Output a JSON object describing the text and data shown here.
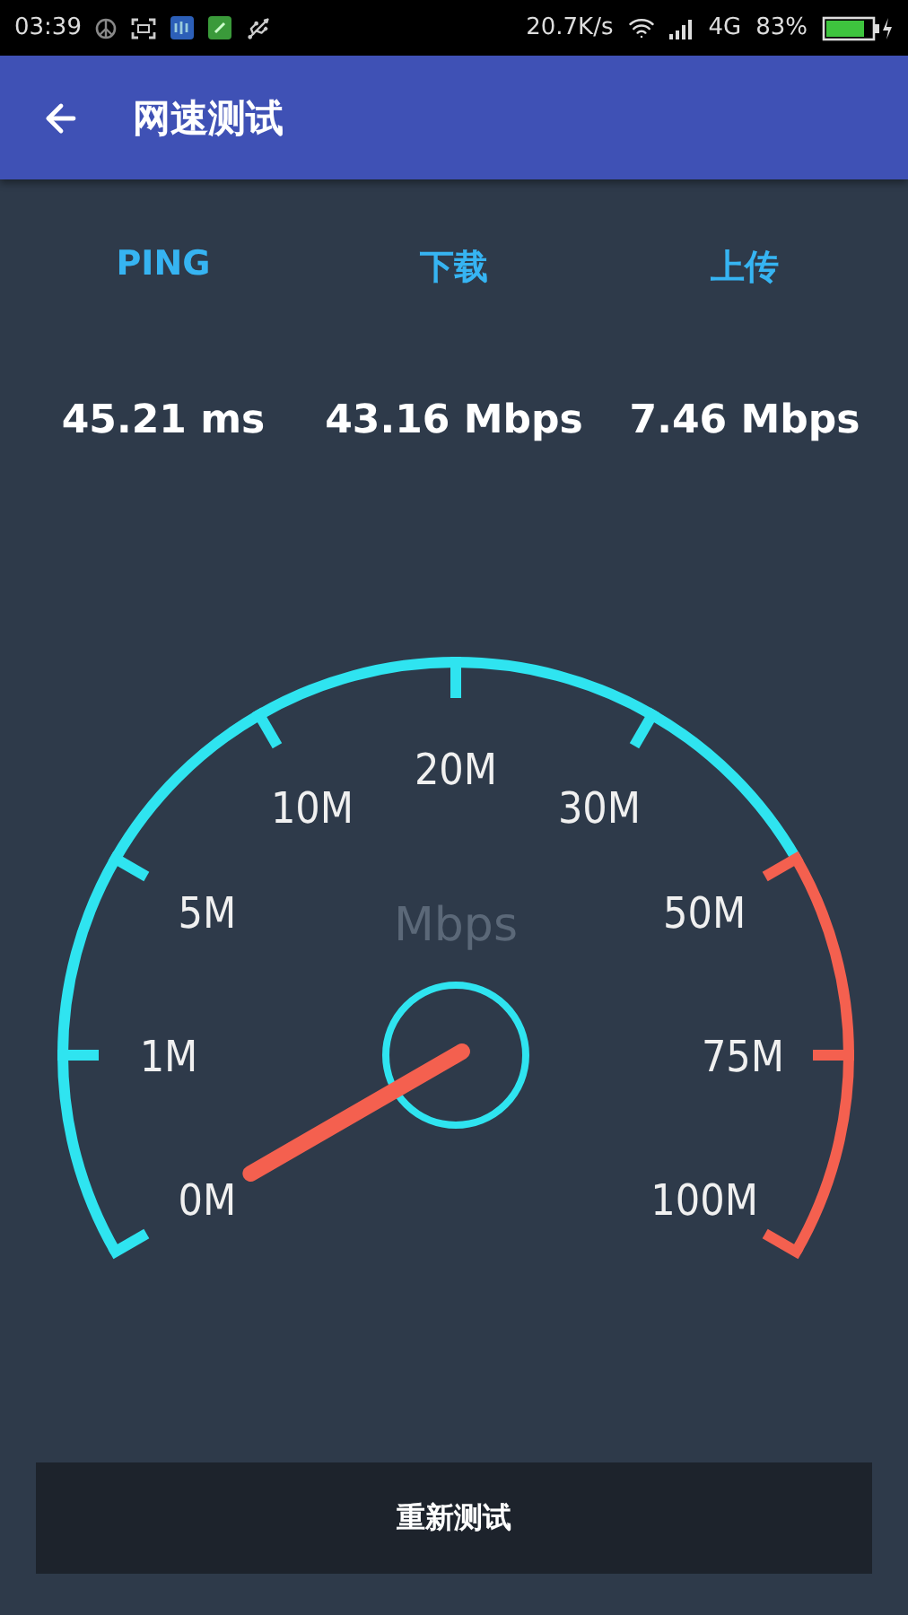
{
  "status_bar": {
    "time": "03:39",
    "net_speed": "20.7K/s",
    "network": "4G",
    "battery": "83%"
  },
  "app_bar": {
    "title": "网速测试"
  },
  "stats": [
    {
      "label": "PING",
      "value": "45.21 ms"
    },
    {
      "label": "下载",
      "value": "43.16 Mbps"
    },
    {
      "label": "上传",
      "value": "7.46 Mbps"
    }
  ],
  "gauge": {
    "unit": "Mbps",
    "ticks": [
      {
        "label": "0M",
        "color": "#2fe4f0"
      },
      {
        "label": "1M",
        "color": "#2fe4f0"
      },
      {
        "label": "5M",
        "color": "#2fe4f0"
      },
      {
        "label": "10M",
        "color": "#2fe4f0"
      },
      {
        "label": "20M",
        "color": "#2fe4f0"
      },
      {
        "label": "30M",
        "color": "#2fe4f0"
      },
      {
        "label": "50M",
        "color": "#f4604f"
      },
      {
        "label": "75M",
        "color": "#f4604f"
      },
      {
        "label": "100M",
        "color": "#f4604f"
      }
    ]
  },
  "retest_button": {
    "label": "重新测试"
  }
}
